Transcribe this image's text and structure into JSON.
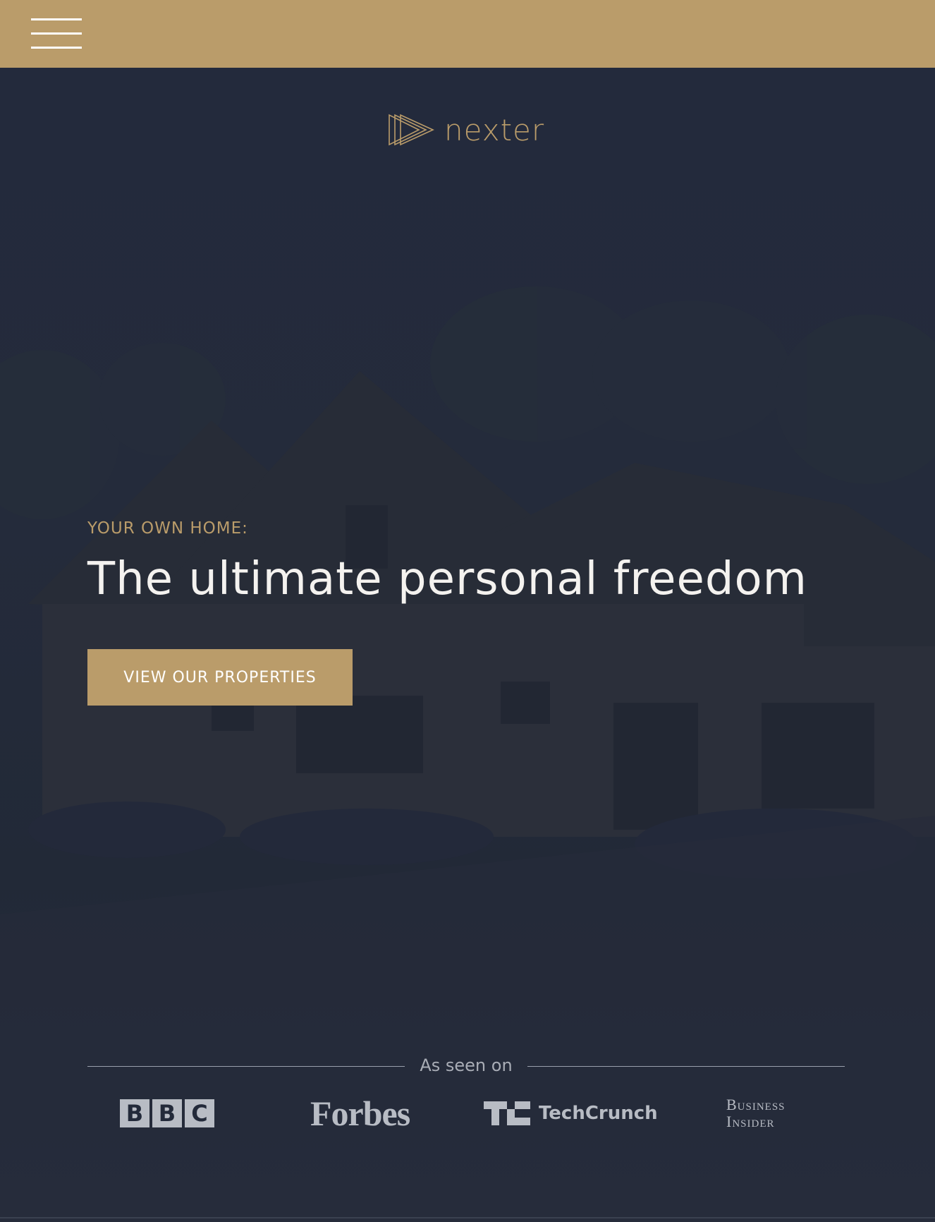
{
  "nav": {
    "menu_icon": "hamburger-menu-icon"
  },
  "logo": {
    "text": "nexter",
    "icon": "triple-triangle-play-icon"
  },
  "hero": {
    "eyebrow": "YOUR OWN HOME:",
    "headline": "The ultimate personal freedom",
    "cta_label": "VIEW OUR PROPERTIES"
  },
  "press": {
    "heading": "As seen on",
    "bbc": [
      "B",
      "B",
      "C"
    ],
    "forbes": "Forbes",
    "techcrunch": "TechCrunch",
    "business_insider": [
      "Business",
      "Insider"
    ]
  },
  "colors": {
    "accent": "#ba9c6a",
    "background": "#232a3a",
    "headline": "#f4f2ef",
    "logo_gray": "#b8bcc4"
  }
}
